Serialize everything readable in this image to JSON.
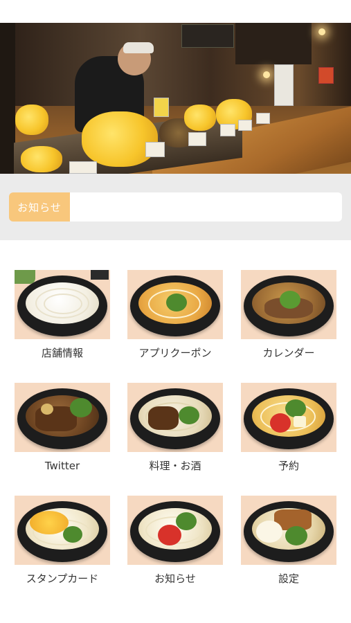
{
  "notice": {
    "label": "お知らせ",
    "text": ""
  },
  "menu": [
    {
      "label": "店舗情報"
    },
    {
      "label": "アプリクーポン"
    },
    {
      "label": "カレンダー"
    },
    {
      "label": "Twitter"
    },
    {
      "label": "料理・お酒"
    },
    {
      "label": "予約"
    },
    {
      "label": "スタンプカード"
    },
    {
      "label": "お知らせ"
    },
    {
      "label": "設定"
    }
  ],
  "colors": {
    "accent": "#f8c77c",
    "notice_bg": "#ebebeb",
    "tile_bg": "#f6d9c1",
    "text": "#333333"
  }
}
